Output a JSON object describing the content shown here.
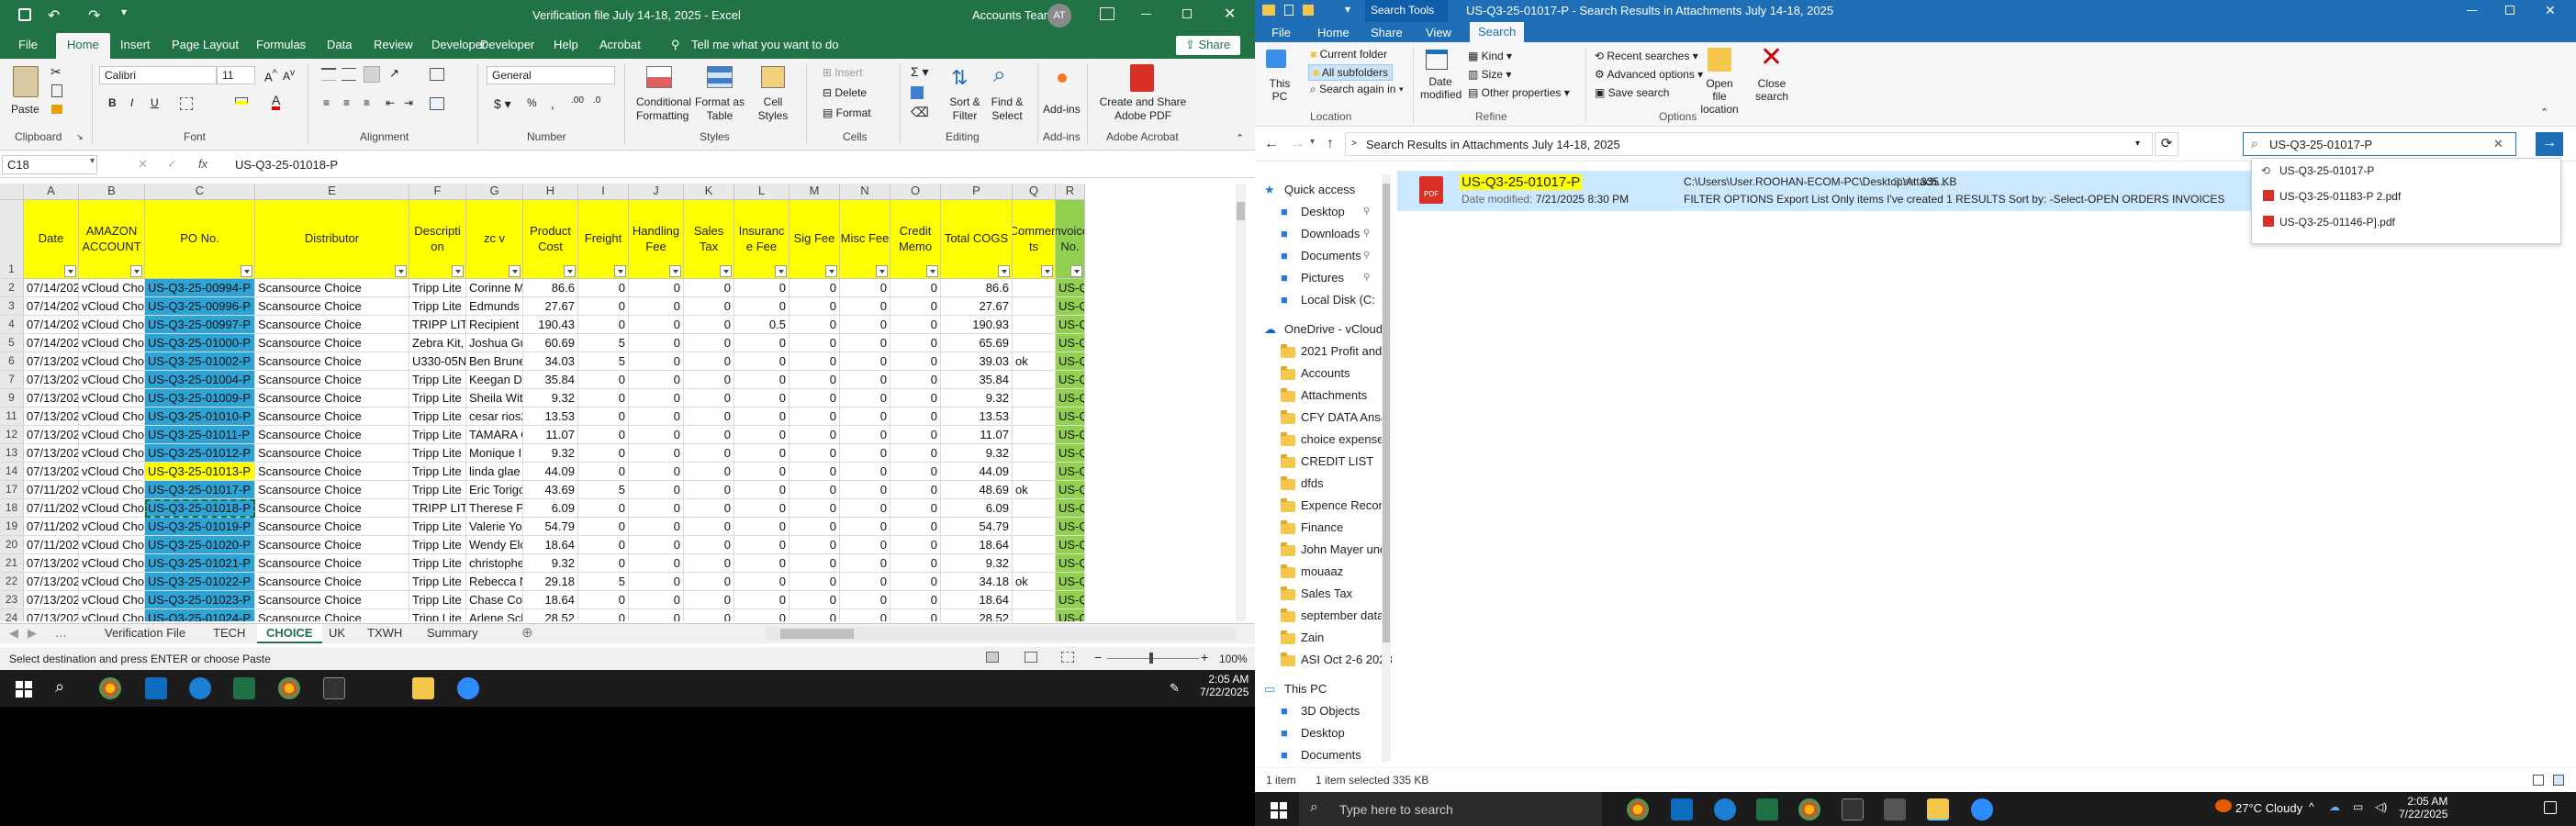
{
  "excel": {
    "title": "Verification file July 14-18, 2025  -  Excel",
    "account": "Accounts Team",
    "avatar": "AT",
    "share_label": "Share",
    "tell_me": "Tell me what you want to do",
    "tabs": [
      "File",
      "Home",
      "Insert",
      "Page Layout",
      "Formulas",
      "Data",
      "Review",
      "Developer",
      "Help",
      "Acrobat"
    ],
    "ribbon": {
      "font_name": "Calibri",
      "font_size": "11",
      "number_format": "General",
      "groups": [
        "Clipboard",
        "Font",
        "Alignment",
        "Number",
        "Styles",
        "Cells",
        "Editing",
        "Add-ins",
        "Adobe Acrobat"
      ],
      "paste": "Paste",
      "cond_format": "Conditional Formatting",
      "format_table": "Format as Table",
      "cell_styles": "Cell Styles",
      "insert": "Insert",
      "delete": "Delete",
      "format": "Format",
      "sort_filter": "Sort & Filter",
      "find_select": "Find & Select",
      "addins": "Add-ins",
      "create_pdf": "Create and Share Adobe PDF"
    },
    "name_box": "C18",
    "formula": "US-Q3-25-01018-P",
    "columns": [
      "A",
      "B",
      "C",
      "E",
      "F",
      "G",
      "H",
      "I",
      "J",
      "K",
      "L",
      "M",
      "N",
      "O",
      "P",
      "Q",
      "R"
    ],
    "headers": [
      "Date",
      "AMAZON ACCOUNT",
      "PO No.",
      "Distributor",
      "Descripti on",
      "zc v",
      "Product Cost",
      "Freight",
      "Handling Fee",
      "Sales Tax",
      "Insuranc e Fee",
      "Sig Fee",
      "Misc Fee",
      "Credit Memo",
      "Total COGS",
      "Commen ts",
      "Invoice No."
    ],
    "rows": [
      {
        "n": "2",
        "date": "07/14/2025",
        "acct": "vCloud Choice",
        "po": "US-Q3-25-00994-P",
        "dist": "Scansource Choice",
        "desc": "Tripp Lite",
        "name": "Corinne M",
        "cost": "86.6",
        "fr": "0",
        "hf": "0",
        "st": "0",
        "ins": "0",
        "sig": "0",
        "misc": "0",
        "cm": "0",
        "total": "86.6",
        "com": "",
        "inv": "US-Q3-2"
      },
      {
        "n": "3",
        "date": "07/14/2025",
        "acct": "vCloud Choice",
        "po": "US-Q3-25-00996-P",
        "dist": "Scansource Choice",
        "desc": "Tripp Lite",
        "name": "Edmunds",
        "cost": "27.67",
        "fr": "0",
        "hf": "0",
        "st": "0",
        "ins": "0",
        "sig": "0",
        "misc": "0",
        "cm": "0",
        "total": "27.67",
        "com": "",
        "inv": "US-Q3-2"
      },
      {
        "n": "4",
        "date": "07/14/2025",
        "acct": "vCloud Choice",
        "po": "US-Q3-25-00997-P",
        "dist": "Scansource Choice",
        "desc": "TRIPP LITI",
        "name": "Recipient",
        "cost": "190.43",
        "fr": "0",
        "hf": "0",
        "st": "0",
        "ins": "0.5",
        "sig": "0",
        "misc": "0",
        "cm": "0",
        "total": "190.93",
        "com": "",
        "inv": "US-Q3-2"
      },
      {
        "n": "5",
        "date": "07/14/2025",
        "acct": "vCloud Choice",
        "po": "US-Q3-25-01000-P",
        "dist": "Scansource Choice",
        "desc": "Zebra Kit,",
        "name": "Joshua Gu",
        "cost": "60.69",
        "fr": "5",
        "hf": "0",
        "st": "0",
        "ins": "0",
        "sig": "0",
        "misc": "0",
        "cm": "0",
        "total": "65.69",
        "com": "",
        "inv": "US-Q3-2"
      },
      {
        "n": "6",
        "date": "07/13/2025",
        "acct": "vCloud Choice",
        "po": "US-Q3-25-01002-P",
        "dist": "Scansource Choice",
        "desc": "U330-05N",
        "name": "Ben Brune",
        "cost": "34.03",
        "fr": "5",
        "hf": "0",
        "st": "0",
        "ins": "0",
        "sig": "0",
        "misc": "0",
        "cm": "0",
        "total": "39.03",
        "com": "ok",
        "inv": "US-Q3-2"
      },
      {
        "n": "7",
        "date": "07/13/2025",
        "acct": "vCloud Choice",
        "po": "US-Q3-25-01004-P",
        "dist": "Scansource Choice",
        "desc": "Tripp Lite",
        "name": "Keegan Dy",
        "cost": "35.84",
        "fr": "0",
        "hf": "0",
        "st": "0",
        "ins": "0",
        "sig": "0",
        "misc": "0",
        "cm": "0",
        "total": "35.84",
        "com": "",
        "inv": "US-Q3-2"
      },
      {
        "n": "9",
        "date": "07/13/2025",
        "acct": "vCloud Choice",
        "po": "US-Q3-25-01009-P",
        "dist": "Scansource Choice",
        "desc": "Tripp Lite",
        "name": "Sheila Wit",
        "cost": "9.32",
        "fr": "0",
        "hf": "0",
        "st": "0",
        "ins": "0",
        "sig": "0",
        "misc": "0",
        "cm": "0",
        "total": "9.32",
        "com": "",
        "inv": "US-Q3-2"
      },
      {
        "n": "11",
        "date": "07/13/2025",
        "acct": "vCloud Choice",
        "po": "US-Q3-25-01010-P",
        "dist": "Scansource Choice",
        "desc": "Tripp Lite",
        "name": "cesar rios2",
        "cost": "13.53",
        "fr": "0",
        "hf": "0",
        "st": "0",
        "ins": "0",
        "sig": "0",
        "misc": "0",
        "cm": "0",
        "total": "13.53",
        "com": "",
        "inv": "US-Q3-2"
      },
      {
        "n": "12",
        "date": "07/13/2025",
        "acct": "vCloud Choice",
        "po": "US-Q3-25-01011-P",
        "dist": "Scansource Choice",
        "desc": "Tripp Lite",
        "name": "TAMARA C",
        "cost": "11.07",
        "fr": "0",
        "hf": "0",
        "st": "0",
        "ins": "0",
        "sig": "0",
        "misc": "0",
        "cm": "0",
        "total": "11.07",
        "com": "",
        "inv": "US-Q3-2"
      },
      {
        "n": "13",
        "date": "07/13/2025",
        "acct": "vCloud Choice",
        "po": "US-Q3-25-01012-P",
        "dist": "Scansource Choice",
        "desc": "Tripp Lite",
        "name": "Monique I",
        "cost": "9.32",
        "fr": "0",
        "hf": "0",
        "st": "0",
        "ins": "0",
        "sig": "0",
        "misc": "0",
        "cm": "0",
        "total": "9.32",
        "com": "",
        "inv": "US-Q3-2"
      },
      {
        "n": "14",
        "date": "07/13/2025",
        "acct": "vCloud Choice",
        "po": "US-Q3-25-01013-P",
        "dist": "Scansource Choice",
        "desc": "Tripp Lite",
        "name": "linda glae",
        "cost": "44.09",
        "fr": "0",
        "hf": "0",
        "st": "0",
        "ins": "0",
        "sig": "0",
        "misc": "0",
        "cm": "0",
        "total": "44.09",
        "com": "",
        "inv": "US-Q3-2",
        "yellow": true
      },
      {
        "n": "17",
        "date": "07/11/2025",
        "acct": "vCloud Choice",
        "po": "US-Q3-25-01017-P",
        "dist": "Scansource Choice",
        "desc": "Tripp Lite",
        "name": "Eric Torigc",
        "cost": "43.69",
        "fr": "5",
        "hf": "0",
        "st": "0",
        "ins": "0",
        "sig": "0",
        "misc": "0",
        "cm": "0",
        "total": "48.69",
        "com": "ok",
        "inv": "US-Q3-2"
      },
      {
        "n": "18",
        "date": "07/11/2025",
        "acct": "vCloud Choice",
        "po": "US-Q3-25-01018-P",
        "dist": "Scansource Choice",
        "desc": "TRIPP LITI",
        "name": "Therese P",
        "cost": "6.09",
        "fr": "0",
        "hf": "0",
        "st": "0",
        "ins": "0",
        "sig": "0",
        "misc": "0",
        "cm": "0",
        "total": "6.09",
        "com": "",
        "inv": "US-Q3-2",
        "selected": true
      },
      {
        "n": "19",
        "date": "07/11/2025",
        "acct": "vCloud Choice",
        "po": "US-Q3-25-01019-P",
        "dist": "Scansource Choice",
        "desc": "Tripp Lite",
        "name": "Valerie Yo",
        "cost": "54.79",
        "fr": "0",
        "hf": "0",
        "st": "0",
        "ins": "0",
        "sig": "0",
        "misc": "0",
        "cm": "0",
        "total": "54.79",
        "com": "",
        "inv": "US-Q3-2"
      },
      {
        "n": "20",
        "date": "07/11/2025",
        "acct": "vCloud Choice",
        "po": "US-Q3-25-01020-P",
        "dist": "Scansource Choice",
        "desc": "Tripp Lite",
        "name": "Wendy Elc",
        "cost": "18.64",
        "fr": "0",
        "hf": "0",
        "st": "0",
        "ins": "0",
        "sig": "0",
        "misc": "0",
        "cm": "0",
        "total": "18.64",
        "com": "",
        "inv": "US-Q3-2"
      },
      {
        "n": "21",
        "date": "07/13/2025",
        "acct": "vCloud Choice",
        "po": "US-Q3-25-01021-P",
        "dist": "Scansource Choice",
        "desc": "Tripp Lite",
        "name": "christophe",
        "cost": "9.32",
        "fr": "0",
        "hf": "0",
        "st": "0",
        "ins": "0",
        "sig": "0",
        "misc": "0",
        "cm": "0",
        "total": "9.32",
        "com": "",
        "inv": "US-Q3-2"
      },
      {
        "n": "22",
        "date": "07/13/2025",
        "acct": "vCloud Choice",
        "po": "US-Q3-25-01022-P",
        "dist": "Scansource Choice",
        "desc": "Tripp Lite",
        "name": "Rebecca N",
        "cost": "29.18",
        "fr": "5",
        "hf": "0",
        "st": "0",
        "ins": "0",
        "sig": "0",
        "misc": "0",
        "cm": "0",
        "total": "34.18",
        "com": "ok",
        "inv": "US-Q3-2"
      },
      {
        "n": "23",
        "date": "07/13/2025",
        "acct": "vCloud Choice",
        "po": "US-Q3-25-01023-P",
        "dist": "Scansource Choice",
        "desc": "Tripp Lite",
        "name": "Chase Coa",
        "cost": "18.64",
        "fr": "0",
        "hf": "0",
        "st": "0",
        "ins": "0",
        "sig": "0",
        "misc": "0",
        "cm": "0",
        "total": "18.64",
        "com": "",
        "inv": "US-Q3-2"
      },
      {
        "n": "24",
        "date": "07/13/2025",
        "acct": "vCloud Choice",
        "po": "US-Q3-25-01024-P",
        "dist": "Scansource Choice",
        "desc": "Tripp Lite",
        "name": "Arlene Sch",
        "cost": "28.52",
        "fr": "0",
        "hf": "0",
        "st": "0",
        "ins": "0",
        "sig": "0",
        "misc": "0",
        "cm": "0",
        "total": "28.52",
        "com": "",
        "inv": "US-Q3-2"
      }
    ],
    "sheets": [
      "Verification File",
      "TECH",
      "CHOICE",
      "UK",
      "TXWH",
      "Summary"
    ],
    "active_sheet": "CHOICE",
    "status_text": "Select destination and press ENTER or choose Paste",
    "zoom": "100%"
  },
  "explorer": {
    "title": "US-Q3-25-01017-P - Search Results in Attachments July 14-18, 2025",
    "search_tools": "Search Tools",
    "tabs": [
      "File",
      "Home",
      "Share",
      "View",
      "Search"
    ],
    "ribbon": {
      "this_pc": "This PC",
      "current_folder": "Current folder",
      "all_subfolders": "All subfolders",
      "search_again": "Search again in",
      "location": "Location",
      "date_modified": "Date modified",
      "kind": "Kind",
      "size": "Size",
      "other_props": "Other properties",
      "refine": "Refine",
      "recent_searches": "Recent searches",
      "advanced_options": "Advanced options",
      "save_search": "Save search",
      "open_file_location": "Open file location",
      "close_search": "Close search",
      "options": "Options"
    },
    "address": "Search Results in Attachments July 14-18, 2025",
    "search_value": "US-Q3-25-01017-P",
    "suggestions": [
      "US-Q3-25-01017-P",
      "US-Q3-25-01183-P 2.pdf",
      "US-Q3-25-01146-P].pdf"
    ],
    "nav": {
      "quick_access": "Quick access",
      "pinned": [
        "Desktop",
        "Downloads",
        "Documents",
        "Pictures",
        "Local Disk (C:"
      ],
      "onedrive": "OneDrive - vCloud",
      "folders": [
        "2021 Profit and I",
        "Accounts",
        "Attachments",
        "CFY DATA Ansar",
        "choice expenses",
        "CREDIT LIST",
        "dfds",
        "Expence Reconc",
        "Finance",
        "John Mayer und",
        "mouaaz",
        "Sales Tax",
        "september data",
        "Zain",
        "ASI Oct 2-6 2023"
      ],
      "this_pc": "This PC",
      "pc_items": [
        "3D Objects",
        "Desktop",
        "Documents"
      ]
    },
    "result": {
      "name": "US-Q3-25-01017-P",
      "date_label": "Date modified:",
      "date": "7/21/2025 8:30 PM",
      "path": "C:\\Users\\User.ROOHAN-ECOM-PC\\Desktop\\Attach...",
      "size_label": "Size:",
      "size": "335 KB",
      "snippet": "FILTER OPTIONS Export List Only items I've created 1 RESULTS Sort by: -Select-OPEN ORDERS INVOICES"
    },
    "status": {
      "count": "1 item",
      "selected": "1 item selected  335 KB"
    }
  },
  "taskbar_left": {
    "time": "2:05 AM",
    "date": "7/22/2025"
  },
  "taskbar_right": {
    "search_placeholder": "Type here to search",
    "weather": "27°C  Cloudy",
    "time": "2:05 AM",
    "date": "7/22/2025"
  }
}
